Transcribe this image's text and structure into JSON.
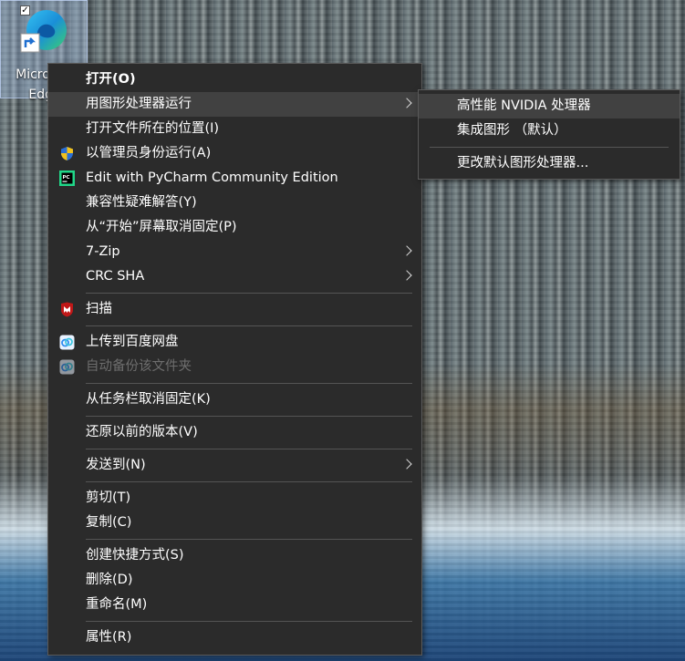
{
  "desktop": {
    "icon_label_line1": "Microsoft",
    "icon_label_line2": "Edge",
    "checkbox_mark": "✓"
  },
  "context_menu": {
    "items": [
      {
        "label": "打开(O)"
      },
      {
        "label": "用图形处理器运行"
      },
      {
        "label": "打开文件所在的位置(I)"
      },
      {
        "label": "以管理员身份运行(A)"
      },
      {
        "label": "Edit with PyCharm Community Edition"
      },
      {
        "label": "兼容性疑难解答(Y)"
      },
      {
        "label": "从“开始”屏幕取消固定(P)"
      },
      {
        "label": "7-Zip"
      },
      {
        "label": "CRC SHA"
      },
      {
        "label": "扫描"
      },
      {
        "label": "上传到百度网盘"
      },
      {
        "label": "自动备份该文件夹"
      },
      {
        "label": "从任务栏取消固定(K)"
      },
      {
        "label": "还原以前的版本(V)"
      },
      {
        "label": "发送到(N)"
      },
      {
        "label": "剪切(T)"
      },
      {
        "label": "复制(C)"
      },
      {
        "label": "创建快捷方式(S)"
      },
      {
        "label": "删除(D)"
      },
      {
        "label": "重命名(M)"
      },
      {
        "label": "属性(R)"
      }
    ]
  },
  "gpu_submenu": {
    "items": [
      {
        "label": "高性能 NVIDIA 处理器"
      },
      {
        "label": "集成图形 （默认）"
      },
      {
        "label": "更改默认图形处理器..."
      }
    ]
  },
  "colors": {
    "menu_bg": "#2b2b2b",
    "hover_bg": "#414141",
    "disabled_text": "#6d6d6d"
  }
}
